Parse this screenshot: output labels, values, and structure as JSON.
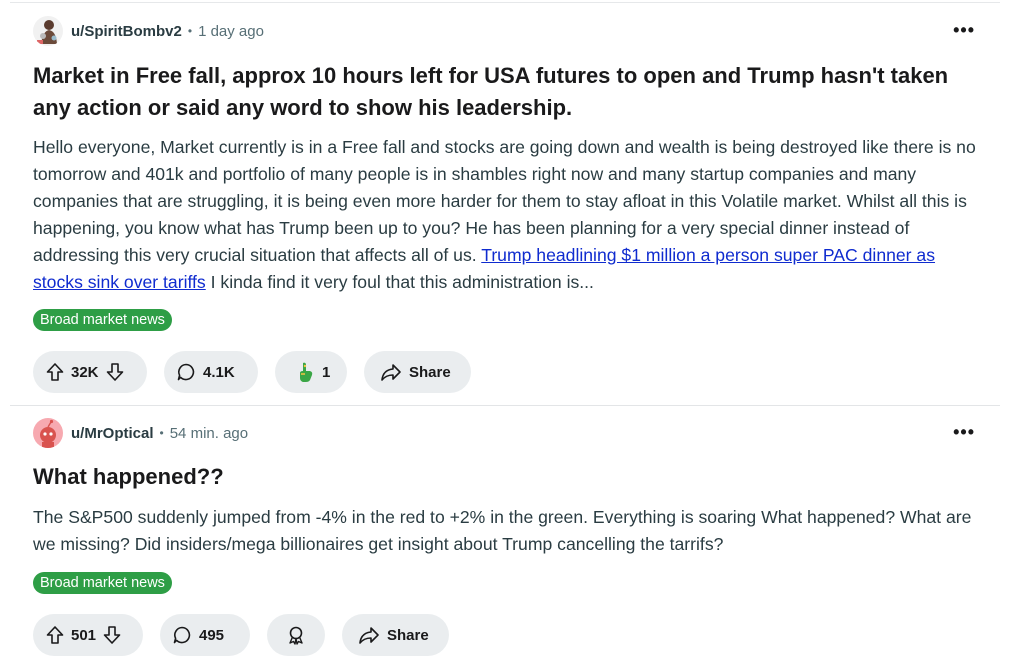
{
  "posts": [
    {
      "username": "u/SpiritBombv2",
      "time": "1 day ago",
      "more": "•••",
      "title": "Market in Free fall, approx 10 hours left for USA futures to open and Trump hasn't taken any action or said any word to show his leadership.",
      "body_text": "Hello everyone, Market currently is in a Free fall and stocks are going down and wealth is being destroyed like there is no tomorrow and 401k and portfolio of many people is in shambles right now and many startup companies and many companies that are struggling, it is being even more harder for them to stay afloat in this Volatile market. Whilst all this is happening, you know what has Trump been up to you? He has been planning for a very special dinner instead of addressing this very crucial situation that affects all of us.",
      "link_text": "Trump headlining $1 million a person super PAC dinner as stocks sink over tariffs",
      "body_tail": " I kinda find it very foul that this administration is...",
      "flair": "Broad market news",
      "flair_color": "#2e9e46",
      "votes": "32K",
      "comments": "4.1K",
      "awards": "1",
      "share": "Share"
    },
    {
      "username": "u/MrOptical",
      "time": "54 min. ago",
      "more": "•••",
      "title": "What happened??",
      "body_text": "The S&P500 suddenly jumped from -4% in the red to +2% in the green. Everything is soaring What happened? What are we missing? Did insiders/mega billionaires get insight about Trump cancelling the tarrifs?",
      "flair": "Broad market news",
      "flair_color": "#2e9e46",
      "votes": "501",
      "comments": "495",
      "share": "Share"
    }
  ],
  "icons": {
    "upvote": "arrow-up-icon",
    "downvote": "arrow-down-icon",
    "comment": "comment-bubble-icon",
    "award": "award-icon",
    "share": "share-arrow-icon"
  }
}
